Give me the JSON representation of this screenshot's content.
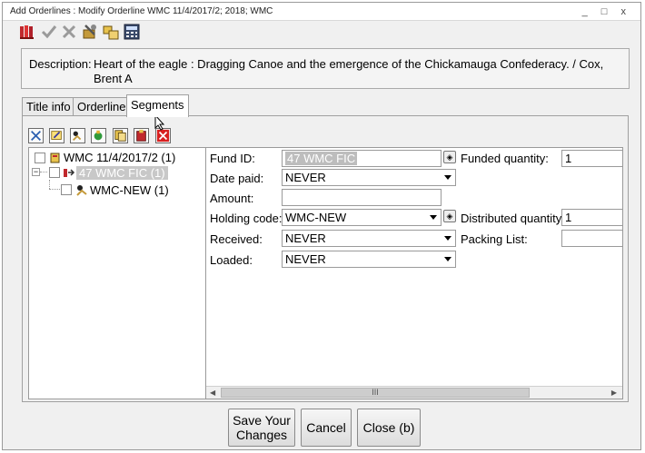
{
  "window": {
    "title": "Add Orderlines : Modify Orderline  WMC 11/4/2017/2; 2018; WMC",
    "controls": "_ □ x"
  },
  "toolbar": {
    "icons": [
      "books-icon",
      "check-icon",
      "delete-icon",
      "tools-icon",
      "folders-icon",
      "calculator-icon"
    ]
  },
  "description": {
    "label": "Description:",
    "text": "Heart of the eagle : Dragging Canoe and the emergence of the Chickamauga Confederacy. / Cox, Brent A"
  },
  "tabs": [
    {
      "label": "Title info",
      "active": false
    },
    {
      "label": "Orderline",
      "active": false
    },
    {
      "label": "Segments",
      "active": true
    }
  ],
  "segment_toolbar": {
    "icons": [
      "expand-icon",
      "edit-icon",
      "add-icon",
      "money-icon",
      "copy-icon",
      "paste-icon",
      "close-icon"
    ]
  },
  "tree": {
    "items": [
      {
        "label": "WMC 11/4/2017/2 (1)",
        "selected": false
      },
      {
        "label": "47 WMC FIC (1)",
        "selected": true
      },
      {
        "label": "WMC-NEW (1)",
        "selected": false
      }
    ]
  },
  "form": {
    "fund_id": {
      "label": "Fund ID:",
      "value": "47 WMC FIC"
    },
    "date_paid": {
      "label": "Date paid:",
      "value": "NEVER"
    },
    "amount": {
      "label": "Amount:",
      "value": ""
    },
    "holding_code": {
      "label": "Holding code:",
      "value": "WMC-NEW"
    },
    "received": {
      "label": "Received:",
      "value": "NEVER"
    },
    "loaded": {
      "label": "Loaded:",
      "value": "NEVER"
    },
    "funded_quantity": {
      "label": "Funded quantity:",
      "value": "1"
    },
    "distributed_quantity": {
      "label": "Distributed quantity:",
      "value": "1"
    },
    "packing_list": {
      "label": "Packing List:",
      "value": ""
    },
    "scroll_grip": "III"
  },
  "buttons": {
    "save": "Save Your Changes",
    "cancel": "Cancel",
    "close": "Close (b)"
  },
  "colors": {
    "selection": "#c8c8c8",
    "window_bg": "#f0f0f0"
  }
}
